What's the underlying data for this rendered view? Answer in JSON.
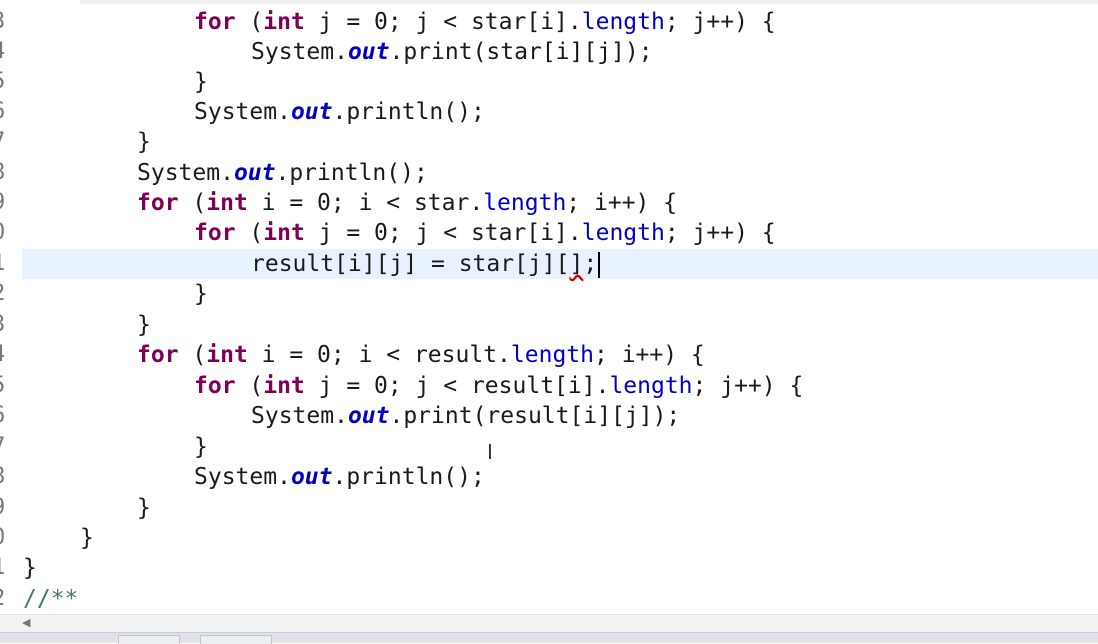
{
  "editor": {
    "lines": [
      {
        "num": "3",
        "indent": "            ",
        "tokens": [
          [
            "kw",
            "for"
          ],
          [
            "",
            "&nbsp;(int j = 0; j < star[i].length; j++) {"
          ]
        ]
      },
      {
        "num": "4"
      },
      {
        "num": "5"
      },
      {
        "num": "6"
      },
      {
        "num": "7"
      },
      {
        "num": "8"
      },
      {
        "num": "9"
      },
      {
        "num": "0"
      },
      {
        "num": "1"
      },
      {
        "num": "2"
      },
      {
        "num": "3"
      },
      {
        "num": "4"
      },
      {
        "num": "5"
      },
      {
        "num": "6"
      },
      {
        "num": "7"
      },
      {
        "num": "8"
      },
      {
        "num": "9"
      },
      {
        "num": "0"
      },
      {
        "num": "1"
      },
      {
        "num": "2"
      }
    ],
    "text": {
      "l1_for": "for",
      "l1_paren": " (",
      "l1_int": "int",
      "l1_a": " j = 0; j < star[i].",
      "l1_length": "length",
      "l1_b": "; j++) {",
      "l2_sys": "System.",
      "l2_out": "out",
      "l2_rest": ".print(star[i][j]);",
      "l3_brace": "}",
      "l4_sys": "System.",
      "l4_out": "out",
      "l4_rest": ".println();",
      "l5_brace": "}",
      "l6_sys": "System.",
      "l6_out": "out",
      "l6_rest": ".println();",
      "l7_for": "for",
      "l7_paren": " (",
      "l7_int": "int",
      "l7_a": " i = 0; i < star.",
      "l7_length": "length",
      "l7_b": "; i++) {",
      "l8_for": "for",
      "l8_paren": " (",
      "l8_int": "int",
      "l8_a": " j = 0; j < star[i].",
      "l8_length": "length",
      "l8_b": "; j++) {",
      "l9_a": "result[i][j] = star[j][",
      "l9_err": "]",
      "l9_b": ";",
      "l10_brace": "}",
      "l11_brace": "}",
      "l12_for": "for",
      "l12_paren": " (",
      "l12_int": "int",
      "l12_a": " i = 0; i < result.",
      "l12_length": "length",
      "l12_b": "; i++) {",
      "l13_for": "for",
      "l13_paren": " (",
      "l13_int": "int",
      "l13_a": " j = 0; j < result[i].",
      "l13_length": "length",
      "l13_b": "; j++) {",
      "l14_sys": "System.",
      "l14_out": "out",
      "l14_rest": ".print(result[i][j]);",
      "l15_brace": "}",
      "l16_sys": "System.",
      "l16_out": "out",
      "l16_rest": ".println();",
      "l17_brace": "}",
      "l18_brace": "}",
      "l19_brace": "}",
      "l20_cmt": "//**"
    }
  },
  "colors": {
    "keyword": "#7f0055",
    "field": "#0000c0",
    "comment": "#3f7f5f",
    "current_line": "#e8f2fe"
  },
  "icons": {
    "cursor": "text-cursor-icon",
    "scroll_left": "scroll-left-arrow-icon"
  }
}
